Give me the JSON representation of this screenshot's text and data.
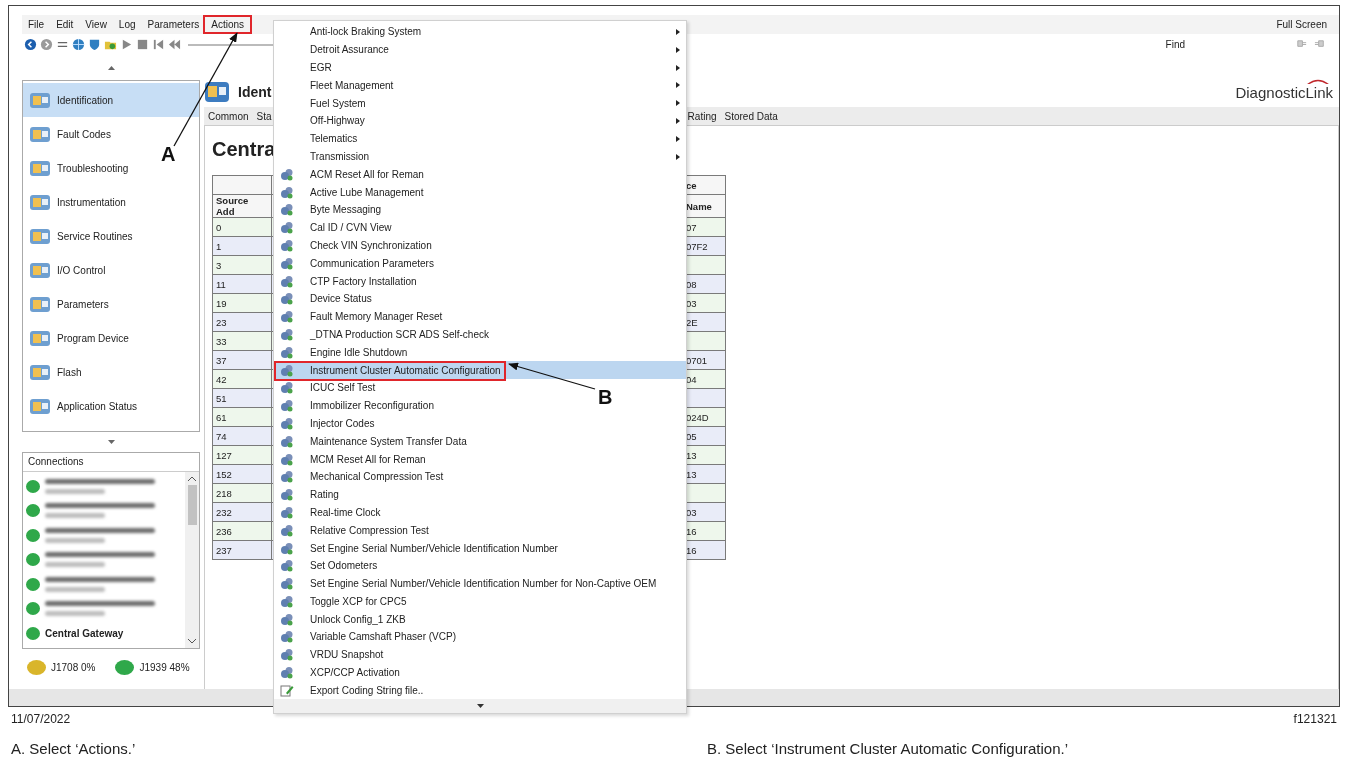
{
  "menu_bar": {
    "items": [
      {
        "label": "File",
        "outlined": false
      },
      {
        "label": "Edit",
        "outlined": false
      },
      {
        "label": "View",
        "outlined": false
      },
      {
        "label": "Log",
        "outlined": false
      },
      {
        "label": "Parameters",
        "outlined": false
      },
      {
        "label": "Actions",
        "outlined": true
      }
    ],
    "right_label": "Full Screen"
  },
  "toolbar": {
    "find_label": "Find"
  },
  "sidebar": {
    "nav_items": [
      {
        "label": "Identification",
        "selected": true
      },
      {
        "label": "Fault Codes",
        "selected": false
      },
      {
        "label": "Troubleshooting",
        "selected": false
      },
      {
        "label": "Instrumentation",
        "selected": false
      },
      {
        "label": "Service Routines",
        "selected": false
      },
      {
        "label": "I/O Control",
        "selected": false
      },
      {
        "label": "Parameters",
        "selected": false
      },
      {
        "label": "Program Device",
        "selected": false
      },
      {
        "label": "Flash",
        "selected": false
      },
      {
        "label": "Application Status",
        "selected": false
      }
    ],
    "connections": {
      "title": "Connections",
      "items": [
        {
          "color": "#2fa84a",
          "blurred": true
        },
        {
          "color": "#2fa84a",
          "blurred": true
        },
        {
          "color": "#2fa84a",
          "blurred": true
        },
        {
          "color": "#2fa84a",
          "blurred": true
        },
        {
          "color": "#2fa84a",
          "blurred": true
        },
        {
          "color": "#2fa84a",
          "blurred": true
        },
        {
          "color": "#2fa84a",
          "blurred": false,
          "name": "Central Gateway"
        }
      ]
    },
    "bus_status": [
      {
        "label": "J1708 0%",
        "color": "#d9b52a"
      },
      {
        "label": "J1939 48%",
        "color": "#2fa84a"
      }
    ]
  },
  "main": {
    "title": "Ident",
    "logo": "DiagnosticLink",
    "tabs": [
      "Common",
      "Sta",
      "Rating",
      "Stored Data"
    ],
    "heading": "Centra",
    "table": {
      "group_header": "ce",
      "columns": [
        "Source Add",
        "Name"
      ],
      "rows": [
        {
          "address": "0",
          "name": "07"
        },
        {
          "address": "1",
          "name": "07F2"
        },
        {
          "address": "3"
        },
        {
          "address": "11",
          "name": "08"
        },
        {
          "address": "19",
          "name": "03"
        },
        {
          "address": "23",
          "name": "2E"
        },
        {
          "address": "33"
        },
        {
          "address": "37",
          "name": "0701"
        },
        {
          "address": "42",
          "name": "04"
        },
        {
          "address": "51"
        },
        {
          "address": "61",
          "name": "024D"
        },
        {
          "address": "74",
          "name": "05"
        },
        {
          "address": "127",
          "name": "13"
        },
        {
          "address": "152",
          "name": "13"
        },
        {
          "address": "218"
        },
        {
          "address": "232",
          "name": "03"
        },
        {
          "address": "236",
          "name": "16"
        },
        {
          "address": "237",
          "name": "16"
        }
      ]
    }
  },
  "actions_menu": {
    "items": [
      {
        "label": "Anti-lock Braking System",
        "kind": "submenu",
        "selected": false,
        "outlined": false
      },
      {
        "label": "Detroit Assurance",
        "kind": "submenu",
        "selected": false,
        "outlined": false
      },
      {
        "label": "EGR",
        "kind": "submenu",
        "selected": false,
        "outlined": false
      },
      {
        "label": "Fleet Management",
        "kind": "submenu",
        "selected": false,
        "outlined": false
      },
      {
        "label": "Fuel System",
        "kind": "submenu",
        "selected": false,
        "outlined": false
      },
      {
        "label": "Off-Highway",
        "kind": "submenu",
        "selected": false,
        "outlined": false
      },
      {
        "label": "Telematics",
        "kind": "submenu",
        "selected": false,
        "outlined": false
      },
      {
        "label": "Transmission",
        "kind": "submenu",
        "selected": false,
        "outlined": false
      },
      {
        "label": "ACM Reset All for Reman",
        "kind": "action",
        "selected": false,
        "outlined": false
      },
      {
        "label": "Active Lube Management",
        "kind": "action",
        "selected": false,
        "outlined": false
      },
      {
        "label": "Byte Messaging",
        "kind": "action",
        "selected": false,
        "outlined": false
      },
      {
        "label": "Cal ID / CVN View",
        "kind": "action",
        "selected": false,
        "outlined": false
      },
      {
        "label": "Check VIN Synchronization",
        "kind": "action",
        "selected": false,
        "outlined": false
      },
      {
        "label": "Communication Parameters",
        "kind": "action",
        "selected": false,
        "outlined": false
      },
      {
        "label": "CTP Factory Installation",
        "kind": "action",
        "selected": false,
        "outlined": false
      },
      {
        "label": "Device Status",
        "kind": "action",
        "selected": false,
        "outlined": false
      },
      {
        "label": "Fault Memory Manager Reset",
        "kind": "action",
        "selected": false,
        "outlined": false
      },
      {
        "label": "_DTNA Production SCR ADS Self-check",
        "kind": "action",
        "selected": false,
        "outlined": false
      },
      {
        "label": "Engine Idle Shutdown",
        "kind": "action",
        "selected": false,
        "outlined": false
      },
      {
        "label": "Instrument Cluster Automatic Configuration",
        "kind": "action",
        "selected": true,
        "outlined": true
      },
      {
        "label": "ICUC Self Test",
        "kind": "action",
        "selected": false,
        "outlined": false
      },
      {
        "label": "Immobilizer Reconfiguration",
        "kind": "action",
        "selected": false,
        "outlined": false
      },
      {
        "label": "Injector Codes",
        "kind": "action",
        "selected": false,
        "outlined": false
      },
      {
        "label": "Maintenance System Transfer Data",
        "kind": "action",
        "selected": false,
        "outlined": false
      },
      {
        "label": "MCM Reset All for Reman",
        "kind": "action",
        "selected": false,
        "outlined": false
      },
      {
        "label": "Mechanical Compression Test",
        "kind": "action",
        "selected": false,
        "outlined": false
      },
      {
        "label": "Rating",
        "kind": "action",
        "selected": false,
        "outlined": false
      },
      {
        "label": "Real-time Clock",
        "kind": "action",
        "selected": false,
        "outlined": false
      },
      {
        "label": "Relative Compression Test",
        "kind": "action",
        "selected": false,
        "outlined": false
      },
      {
        "label": "Set Engine Serial Number/Vehicle Identification Number",
        "kind": "action",
        "selected": false,
        "outlined": false
      },
      {
        "label": "Set Odometers",
        "kind": "action",
        "selected": false,
        "outlined": false
      },
      {
        "label": "Set Engine Serial Number/Vehicle Identification Number for Non-Captive OEM",
        "kind": "action",
        "selected": false,
        "outlined": false
      },
      {
        "label": "Toggle XCP for CPC5",
        "kind": "action",
        "selected": false,
        "outlined": false
      },
      {
        "label": "Unlock Config_1 ZKB",
        "kind": "action",
        "selected": false,
        "outlined": false
      },
      {
        "label": "Variable Camshaft Phaser (VCP)",
        "kind": "action",
        "selected": false,
        "outlined": false
      },
      {
        "label": "VRDU Snapshot",
        "kind": "action",
        "selected": false,
        "outlined": false
      },
      {
        "label": "XCP/CCP Activation",
        "kind": "action",
        "selected": false,
        "outlined": false
      },
      {
        "label": "Export Coding String file..",
        "kind": "file",
        "selected": false,
        "outlined": false
      }
    ]
  },
  "callouts": [
    {
      "label": "A"
    },
    {
      "label": "B"
    }
  ],
  "footer": {
    "date": "11/07/2022",
    "figure_id": "f121321",
    "captions": [
      "A. Select ‘Actions.’",
      "B. Select ‘Instrument Cluster Automatic Configuration.’"
    ]
  }
}
